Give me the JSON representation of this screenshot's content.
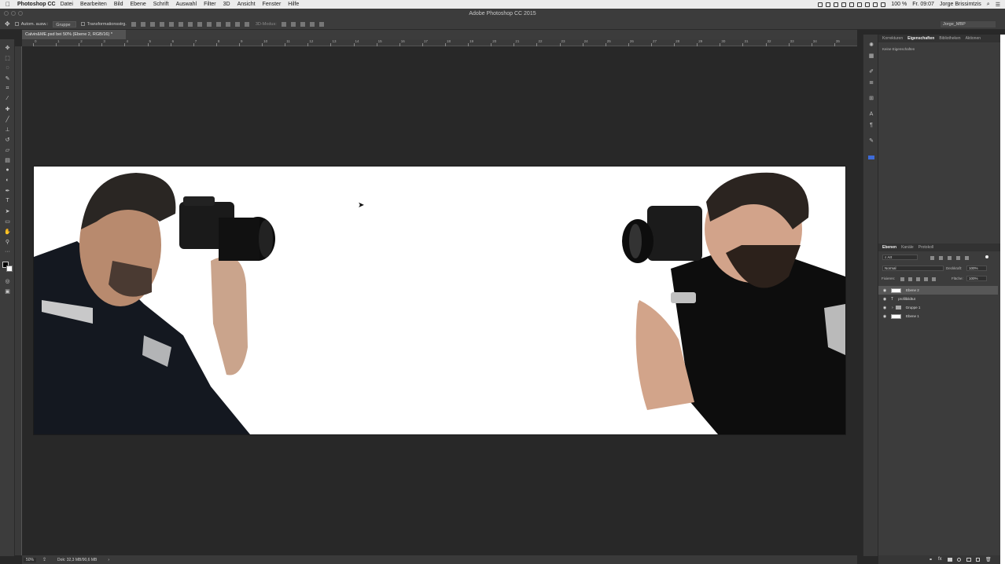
{
  "menubar": {
    "apple_icon": "apple-icon",
    "app_name": "Photoshop CC",
    "items": [
      "Datei",
      "Bearbeiten",
      "Bild",
      "Ebene",
      "Schrift",
      "Auswahl",
      "Filter",
      "3D",
      "Ansicht",
      "Fenster",
      "Hilfe"
    ],
    "battery": "100 %",
    "clock": "Fr. 09:07",
    "user": "Jorge Brissimtzis"
  },
  "window": {
    "title": "Adobe Photoshop CC 2015"
  },
  "options": {
    "auto_select": "Autom. ausw.:",
    "group_select": "Gruppe",
    "transform_controls": "Transformationsstrg.",
    "mode_3d": "3D-Modus:",
    "workspace": "Jorge_MBP"
  },
  "document": {
    "tab_label": "Calvin&ME.psd bei 50% (Ebene 2, RGB/16) *",
    "ruler_ticks": [
      "0",
      "1",
      "2",
      "3",
      "4",
      "5",
      "6",
      "7",
      "8",
      "9",
      "10",
      "11",
      "12",
      "13",
      "14",
      "15",
      "16",
      "17",
      "18",
      "19",
      "20",
      "21",
      "22",
      "23",
      "24",
      "25",
      "26",
      "27",
      "28",
      "29",
      "30",
      "31",
      "32",
      "33",
      "34",
      "35"
    ]
  },
  "status": {
    "zoom": "50%",
    "doc_size": "Dok: 32,3 MB/90,6 MB"
  },
  "properties_panel": {
    "tabs": [
      "Korrekturen",
      "Eigenschaften",
      "Bibliotheken",
      "Aktionen"
    ],
    "active_tab": "Eigenschaften",
    "empty_text": "Keine Eigenschaften"
  },
  "layers_panel": {
    "tabs": [
      "Ebenen",
      "Kanäle",
      "Protokoll"
    ],
    "active_tab": "Ebenen",
    "filter_kind": "Art",
    "blend_mode": "Normal",
    "opacity_label": "Deckkraft:",
    "opacity_value": "100%",
    "lock_label": "Fixieren:",
    "fill_label": "Fläche:",
    "fill_value": "100%",
    "layers": [
      {
        "name": "Ebene 2",
        "selected": true
      },
      {
        "name": "profilbildtut",
        "selected": false
      },
      {
        "name": "Gruppe 1",
        "selected": false
      },
      {
        "name": "Ebene 1",
        "selected": false
      }
    ]
  },
  "colors": {
    "ui_dark": "#3c3c3c",
    "canvas_bg": "#282828",
    "document_bg": "#ffffff"
  }
}
